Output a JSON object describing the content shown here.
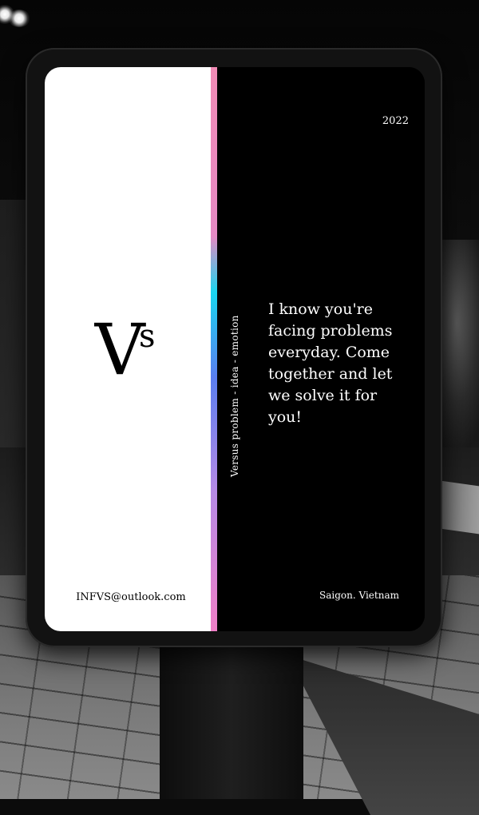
{
  "scene": {
    "icons": [
      "street-light-icon",
      "logo-icon"
    ]
  },
  "billboard": {
    "logo_text": "Vs",
    "email": "INFVS@outlook.com",
    "year": "2022",
    "tagline_vertical": "Versus problem - idea - emotion",
    "message": "I know you're facing problems everyday. Come together and let we solve it for you!",
    "location": "Saigon. Vietnam",
    "colors": {
      "white_panel": "#ffffff",
      "black_panel": "#000000",
      "strip_pink": "#f28bb6",
      "strip_cyan": "#19d6f0",
      "strip_blue": "#5a7ef0",
      "strip_violet": "#b58ae6"
    }
  }
}
